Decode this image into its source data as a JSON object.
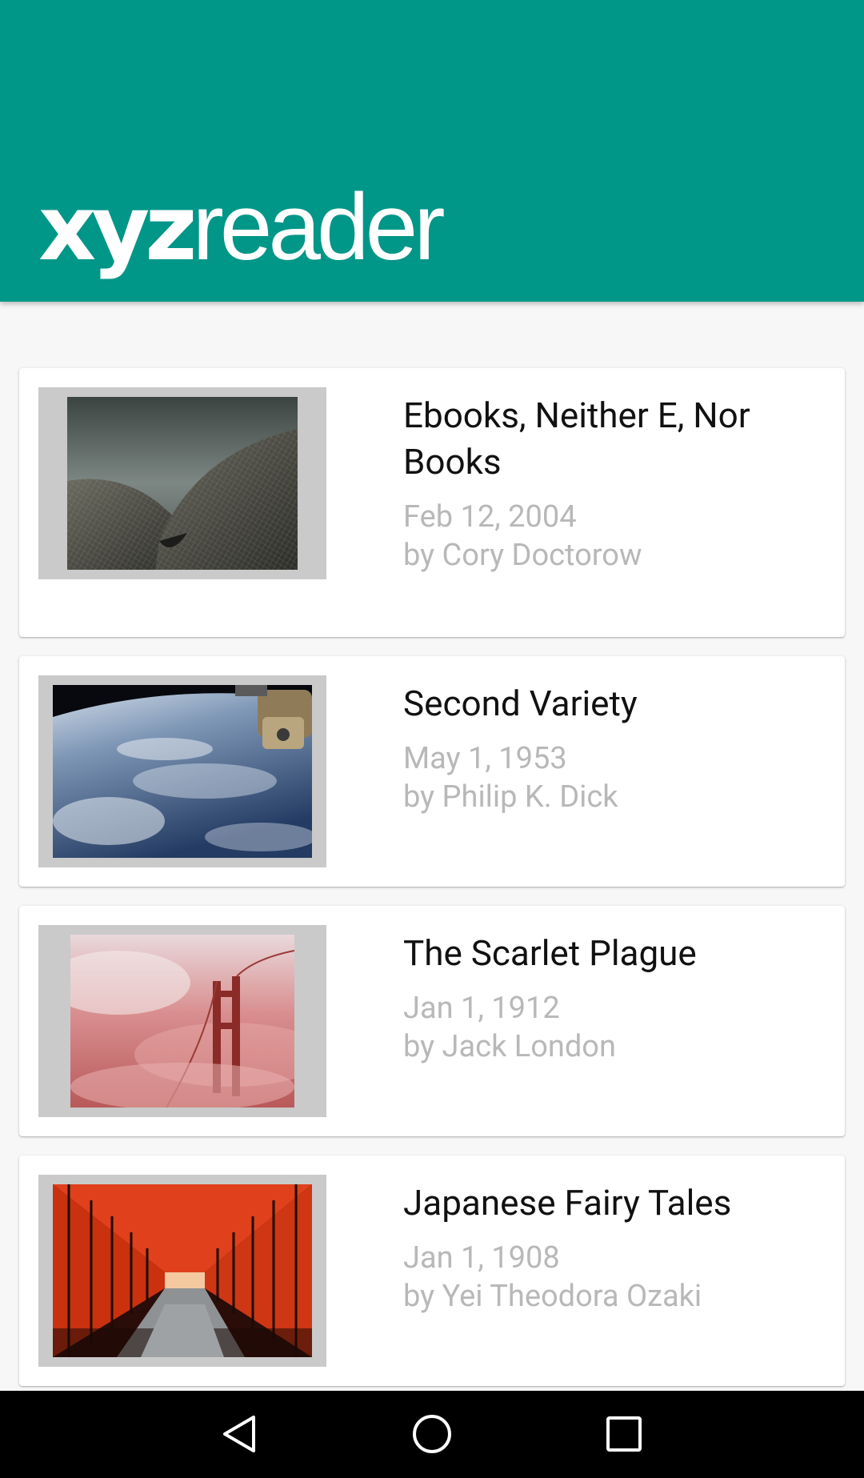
{
  "app": {
    "logo_bold": "xyz",
    "logo_light": "reader",
    "header_color": "#009688"
  },
  "articles": [
    {
      "title": "Ebooks, Neither E, Nor Books",
      "date": "Feb 12, 2004",
      "author": "by Cory Doctorow",
      "thumbnail": "sydney-opera-house-shells-photo"
    },
    {
      "title": "Second Variety",
      "date": "May 1, 1953",
      "author": "by Philip K. Dick",
      "thumbnail": "earth-from-space-station-photo"
    },
    {
      "title": "The Scarlet Plague",
      "date": "Jan 1, 1912",
      "author": "by Jack London",
      "thumbnail": "golden-gate-bridge-in-red-fog-photo"
    },
    {
      "title": "Japanese Fairy Tales",
      "date": "Jan 1, 1908",
      "author": "by Yei Theodora Ozaki",
      "thumbnail": "fushimi-inari-torii-gates-photo"
    }
  ],
  "navigation": {
    "back": "back-icon",
    "home": "home-icon",
    "recents": "recents-icon"
  }
}
